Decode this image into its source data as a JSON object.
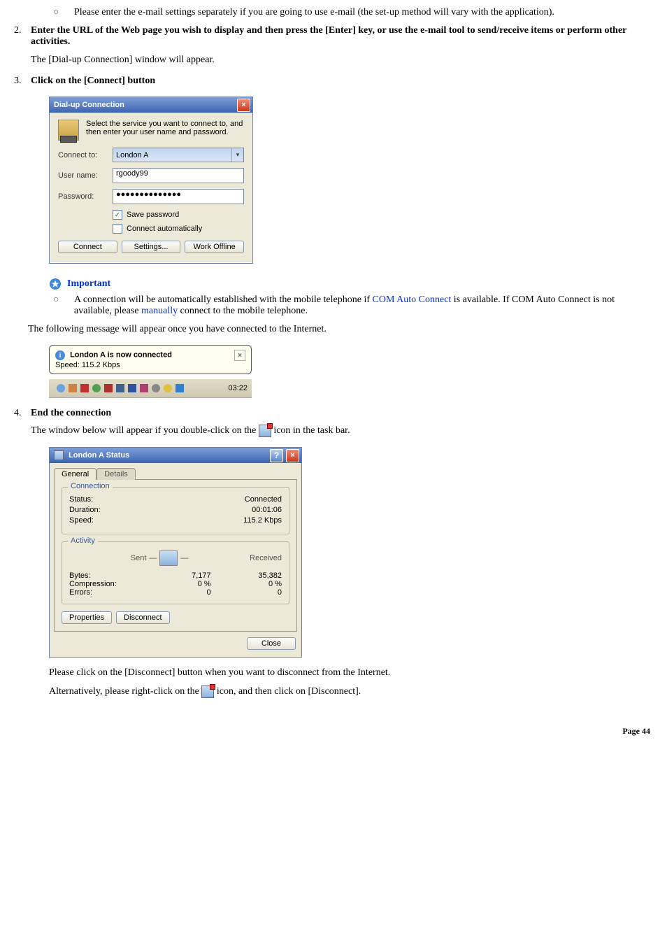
{
  "intro_bullet": "Please enter the e-mail settings separately if you are going to use e-mail (the set-up method will vary with the application).",
  "step2": {
    "num": "2.",
    "title": "Enter the URL of the Web page you wish to display and then press the [Enter] key, or use the e-mail tool to send/receive items or perform other activities.",
    "note": "The [Dial-up Connection] window will appear."
  },
  "step3": {
    "num": "3.",
    "title": "Click on the [Connect] button"
  },
  "dialup": {
    "title": "Dial-up Connection",
    "intro": "Select the service you want to connect to, and then enter your user name and password.",
    "connect_to_lbl": "Connect to:",
    "connect_to_val": "London A",
    "user_lbl": "User name:",
    "user_val": "rgoody99",
    "pwd_lbl": "Password:",
    "pwd_val": "●●●●●●●●●●●●●●",
    "save_pwd": "Save password",
    "auto": "Connect automatically",
    "btn_connect": "Connect",
    "btn_settings": "Settings...",
    "btn_offline": "Work Offline"
  },
  "important": {
    "label": "Important",
    "bullet_pre": "A connection will be automatically established with the mobile telephone if ",
    "link1": "COM Auto Connect",
    "mid": " is available. If COM Auto Connect is not available, please ",
    "link2": "manually",
    "post": " connect to the mobile telephone."
  },
  "after_important": "The following message will appear once you have connected to the Internet.",
  "notif": {
    "title": "London A is now connected",
    "speed": "Speed: 115.2 Kbps",
    "clock": "03:22"
  },
  "step4": {
    "num": "4.",
    "title": "End the connection",
    "line_pre": "The window below will appear if you double-click on the ",
    "line_post": " icon in the task bar."
  },
  "status": {
    "title": "London A Status",
    "tab_general": "General",
    "tab_details": "Details",
    "grp_conn": "Connection",
    "status_lbl": "Status:",
    "status_val": "Connected",
    "dur_lbl": "Duration:",
    "dur_val": "00:01:06",
    "speed_lbl": "Speed:",
    "speed_val": "115.2 Kbps",
    "grp_act": "Activity",
    "sent": "Sent",
    "received": "Received",
    "bytes_lbl": "Bytes:",
    "bytes_sent": "7,177",
    "bytes_recv": "35,382",
    "comp_lbl": "Compression:",
    "comp_sent": "0 %",
    "comp_recv": "0 %",
    "err_lbl": "Errors:",
    "err_sent": "0",
    "err_recv": "0",
    "btn_props": "Properties",
    "btn_disc": "Disconnect",
    "btn_close": "Close"
  },
  "end": {
    "line1": "Please click on the [Disconnect] button when you want to disconnect from the Internet.",
    "line2_pre": "Alternatively, please right-click on the ",
    "line2_post": " icon, and then click on [Disconnect]."
  },
  "page": "Page 44"
}
